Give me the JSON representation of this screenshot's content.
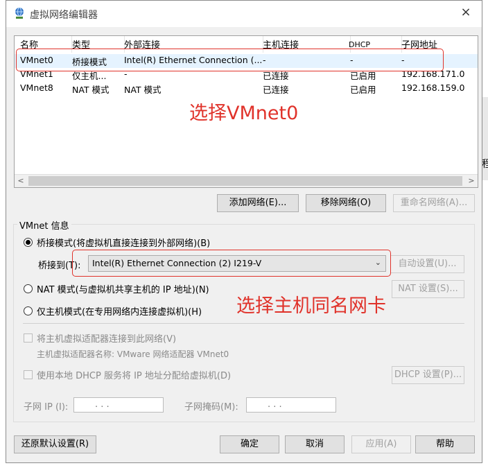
{
  "window": {
    "title": "虚拟网络编辑器",
    "close_icon": "×"
  },
  "table": {
    "columns": [
      "名称",
      "类型",
      "外部连接",
      "主机连接",
      "DHCP",
      "子网地址"
    ],
    "rows": [
      [
        "VMnet0",
        "桥接模式",
        "Intel(R) Ethernet Connection (...",
        "-",
        "-",
        "-"
      ],
      [
        "VMnet1",
        "仅主机...",
        "-",
        "已连接",
        "已启用",
        "192.168.171.0"
      ],
      [
        "VMnet8",
        "NAT 模式",
        "NAT 模式",
        "已连接",
        "已启用",
        "192.168.159.0"
      ]
    ],
    "scroll_left": "<",
    "scroll_right": ">"
  },
  "buttons": {
    "add_network": "添加网络(E)...",
    "remove_network": "移除网络(O)",
    "rename_network": "重命名网络(A)..."
  },
  "vmnet_info": {
    "group_label": "VMnet 信息",
    "bridged_label": "桥接模式(将虚拟机直接连接到外部网络)(B)",
    "bridged_to_label": "桥接到(T):",
    "bridged_adapter": "Intel(R) Ethernet Connection (2) I219-V",
    "auto_settings": "自动设置(U)...",
    "nat_label": "NAT 模式(与虚拟机共享主机的 IP 地址)(N)",
    "nat_settings": "NAT 设置(S)...",
    "host_only_label": "仅主机模式(在专用网络内连接虚拟机)(H)",
    "connect_adapter_label": "将主机虚拟适配器连接到此网络(V)",
    "adapter_name_label": "主机虚拟适配器名称: VMware 网络适配器 VMnet0",
    "use_dhcp_label": "使用本地 DHCP 服务将 IP 地址分配给虚拟机(D)",
    "dhcp_settings": "DHCP 设置(P)...",
    "subnet_ip_label": "子网 IP (I):",
    "subnet_mask_label": "子网掩码(M):",
    "ip_placeholder": ".        .        ."
  },
  "footer": {
    "restore_defaults": "还原默认设置(R)",
    "ok": "确定",
    "cancel": "取消",
    "apply": "应用(A)",
    "help": "帮助"
  },
  "annotations": {
    "select_vmnet0": "选择VMnet0",
    "select_host_adapter": "选择主机同名网卡"
  },
  "background_fragment": "程",
  "colors": {
    "annotation_red": "#e0322a",
    "window_bg": "#f0f0f0"
  }
}
